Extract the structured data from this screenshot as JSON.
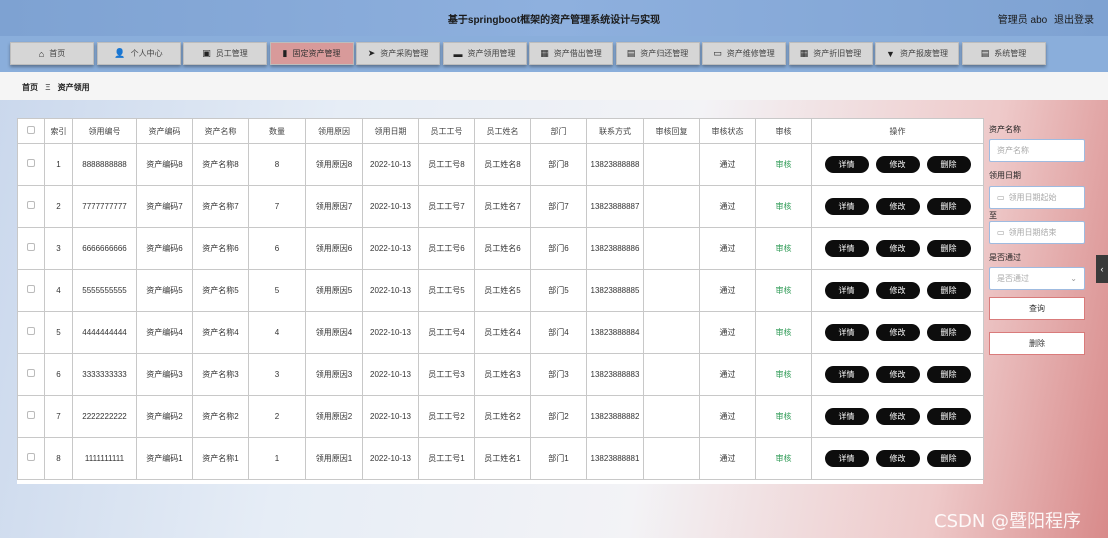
{
  "header": {
    "title": "基于springboot框架的资产管理系统设计与实现",
    "user": "管理员 abo",
    "logout": "退出登录"
  },
  "nav": [
    {
      "label": "首页",
      "icon": "home-icon",
      "glyph": "⌂"
    },
    {
      "label": "个人中心",
      "icon": "user-icon",
      "glyph": "👤"
    },
    {
      "label": "员工管理",
      "icon": "briefcase-icon",
      "glyph": "▣"
    },
    {
      "label": "固定资产管理",
      "icon": "bar-chart-icon",
      "glyph": "▮"
    },
    {
      "label": "资产采购管理",
      "icon": "send-icon",
      "glyph": "➤"
    },
    {
      "label": "资产领用管理",
      "icon": "message-icon",
      "glyph": "▬"
    },
    {
      "label": "资产借出管理",
      "icon": "grid-icon",
      "glyph": "▦"
    },
    {
      "label": "资产归还管理",
      "icon": "trash-icon",
      "glyph": "▤"
    },
    {
      "label": "资产维修管理",
      "icon": "monitor-icon",
      "glyph": "▭"
    },
    {
      "label": "资产折旧管理",
      "icon": "grid-icon",
      "glyph": "▦"
    },
    {
      "label": "资产报废管理",
      "icon": "comment-icon",
      "glyph": "▼"
    },
    {
      "label": "系统管理",
      "icon": "clipboard-icon",
      "glyph": "▤"
    }
  ],
  "breadcrumb": {
    "home": "首页",
    "separator": "Ξ",
    "current": "资产领用"
  },
  "table": {
    "headers": [
      "索引",
      "领用编号",
      "资产编码",
      "资产名称",
      "数量",
      "领用原因",
      "领用日期",
      "员工工号",
      "员工姓名",
      "部门",
      "联系方式",
      "审核回复",
      "审核状态",
      "审核",
      "操作"
    ],
    "op_labels": {
      "detail": "详情",
      "edit": "修改",
      "delete": "删除"
    },
    "rows": [
      {
        "index": "1",
        "code": "8888888888",
        "asset_code": "资产编码8",
        "asset_name": "资产名称8",
        "qty": "8",
        "reason": "领用原因8",
        "date": "2022-10-13",
        "emp_no": "员工工号8",
        "emp_name": "员工姓名8",
        "dept": "部门8",
        "phone": "13823888888",
        "reply": "",
        "status": "通过",
        "audit": "审核"
      },
      {
        "index": "2",
        "code": "7777777777",
        "asset_code": "资产编码7",
        "asset_name": "资产名称7",
        "qty": "7",
        "reason": "领用原因7",
        "date": "2022-10-13",
        "emp_no": "员工工号7",
        "emp_name": "员工姓名7",
        "dept": "部门7",
        "phone": "13823888887",
        "reply": "",
        "status": "通过",
        "audit": "审核"
      },
      {
        "index": "3",
        "code": "6666666666",
        "asset_code": "资产编码6",
        "asset_name": "资产名称6",
        "qty": "6",
        "reason": "领用原因6",
        "date": "2022-10-13",
        "emp_no": "员工工号6",
        "emp_name": "员工姓名6",
        "dept": "部门6",
        "phone": "13823888886",
        "reply": "",
        "status": "通过",
        "audit": "审核"
      },
      {
        "index": "4",
        "code": "5555555555",
        "asset_code": "资产编码5",
        "asset_name": "资产名称5",
        "qty": "5",
        "reason": "领用原因5",
        "date": "2022-10-13",
        "emp_no": "员工工号5",
        "emp_name": "员工姓名5",
        "dept": "部门5",
        "phone": "13823888885",
        "reply": "",
        "status": "通过",
        "audit": "审核"
      },
      {
        "index": "5",
        "code": "4444444444",
        "asset_code": "资产编码4",
        "asset_name": "资产名称4",
        "qty": "4",
        "reason": "领用原因4",
        "date": "2022-10-13",
        "emp_no": "员工工号4",
        "emp_name": "员工姓名4",
        "dept": "部门4",
        "phone": "13823888884",
        "reply": "",
        "status": "通过",
        "audit": "审核"
      },
      {
        "index": "6",
        "code": "3333333333",
        "asset_code": "资产编码3",
        "asset_name": "资产名称3",
        "qty": "3",
        "reason": "领用原因3",
        "date": "2022-10-13",
        "emp_no": "员工工号3",
        "emp_name": "员工姓名3",
        "dept": "部门3",
        "phone": "13823888883",
        "reply": "",
        "status": "通过",
        "audit": "审核"
      },
      {
        "index": "7",
        "code": "2222222222",
        "asset_code": "资产编码2",
        "asset_name": "资产名称2",
        "qty": "2",
        "reason": "领用原因2",
        "date": "2022-10-13",
        "emp_no": "员工工号2",
        "emp_name": "员工姓名2",
        "dept": "部门2",
        "phone": "13823888882",
        "reply": "",
        "status": "通过",
        "audit": "审核"
      },
      {
        "index": "8",
        "code": "1111111111",
        "asset_code": "资产编码1",
        "asset_name": "资产名称1",
        "qty": "1",
        "reason": "领用原因1",
        "date": "2022-10-13",
        "emp_no": "员工工号1",
        "emp_name": "员工姓名1",
        "dept": "部门1",
        "phone": "13823888881",
        "reply": "",
        "status": "通过",
        "audit": "审核"
      }
    ]
  },
  "search": {
    "asset_name_label": "资产名称",
    "asset_name_placeholder": "资产名称",
    "date_label": "领用日期",
    "date_start_placeholder": "领用日期起始",
    "date_to": "至",
    "date_end_placeholder": "领用日期结束",
    "approved_label": "是否通过",
    "approved_placeholder": "是否通过",
    "query_button": "查询",
    "delete_button": "删除"
  },
  "watermark": "CSDN @暨阳程序",
  "colors": {
    "accent": "#8aaedb",
    "active_tab": "#d89a9a",
    "audit_green": "#2e9a55"
  }
}
